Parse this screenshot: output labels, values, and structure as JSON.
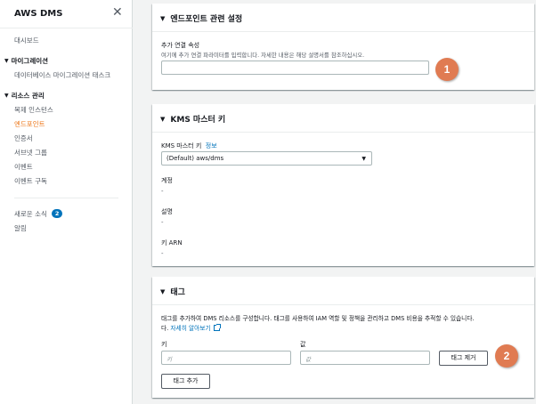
{
  "sidebar": {
    "title": "AWS DMS",
    "dashboard": "대시보드",
    "migration_group": "마이그레이션",
    "db_migration_tasks": "데이터베이스 마이그레이션 태스크",
    "resource_group": "리소스 관리",
    "replication_instances": "복제 인스턴스",
    "endpoints": "엔드포인트",
    "certificates": "인증서",
    "subnet_groups": "서브넷 그룹",
    "events": "이벤트",
    "event_subscriptions": "이벤트 구독",
    "whats_new": "새로운 소식",
    "whats_new_count": "2",
    "notifications": "알림"
  },
  "endpoint_settings": {
    "title": "엔드포인트 관련 설정",
    "extra_attr_label": "추가 연결 속성",
    "extra_attr_desc": "여기에 추가 연결 파라미터를 입력합니다. 자세한 내용은 해당 설명서를 참조하십시오.",
    "extra_attr_value": ""
  },
  "kms": {
    "title": "KMS 마스터 키",
    "key_label": "KMS 마스터 키",
    "info_link": "정보",
    "key_value": "(Default) aws/dms",
    "account_label": "계정",
    "account_value": "-",
    "description_label": "설명",
    "description_value": "-",
    "arn_label": "키 ARN",
    "arn_value": "-"
  },
  "tags": {
    "title": "태그",
    "desc": "태그를 추가하여 DMS 리소스를 구성합니다. 태그를 사용하여 IAM 역할 및 정책을 관리하고 DMS 비용을 추적할 수 있습니다.",
    "learn_more": "자세히 알아보기",
    "key_header": "키",
    "value_header": "값",
    "key_placeholder": "키",
    "value_placeholder": "값",
    "remove_button": "태그 제거",
    "add_button": "태그 추가"
  },
  "markers": {
    "first": "1",
    "second": "2"
  }
}
